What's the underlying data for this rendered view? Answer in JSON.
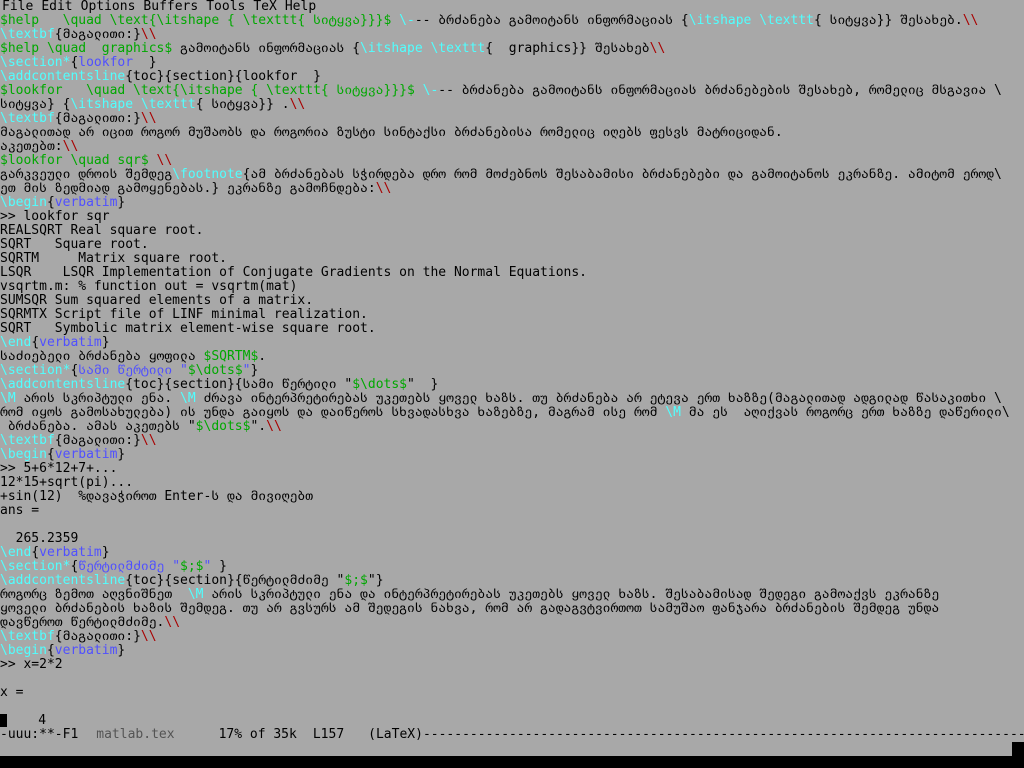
{
  "menubar": {
    "items": [
      "File",
      "Edit",
      "Options",
      "Buffers",
      "Tools",
      "TeX",
      "Help"
    ]
  },
  "buffer": {
    "lines": [
      [
        [
          "math",
          "$help   \\quad \\text{\\itshape { \\texttt{ სიტყვა}}}$ "
        ],
        [
          "cmd",
          "\\-"
        ],
        [
          "",
          "-- ბრძანება გამოიტანს ინფორმაციას {"
        ],
        [
          "cmd",
          "\\itshape \\texttt"
        ],
        [
          "",
          "{ სიტყვა}} შესახებ."
        ],
        [
          "red",
          "\\\\"
        ]
      ],
      [
        [
          "cmd",
          "\\textbf"
        ],
        [
          "",
          "{მაგალითი:}"
        ],
        [
          "red",
          "\\\\"
        ]
      ],
      [
        [
          "math",
          "$help \\quad  graphics$"
        ],
        [
          "",
          "",
          " გამოიტანს ინფორმაციას {"
        ],
        [
          "cmd",
          "\\itshape \\texttt"
        ],
        [
          "",
          "{  graphics}} შესახებ"
        ],
        [
          "red",
          "\\\\"
        ]
      ],
      [
        [
          "cmd",
          "\\section*"
        ],
        [
          "",
          "{"
        ],
        [
          "arg",
          "lookfor  "
        ],
        [
          "",
          "}"
        ]
      ],
      [
        [
          "cmd",
          "\\addcontentsline"
        ],
        [
          "",
          "{toc}{section}{lookfor  }"
        ]
      ],
      [
        [
          "math",
          "$lookfor   \\quad \\text{\\itshape { \\texttt{ სიტყვა}}}$ "
        ],
        [
          "cmd",
          "\\-"
        ],
        [
          "",
          "-- ბრძანება გამოიტანს ინფორმაციას ბრძანებების შესახებ, რომელიც მსგავია \\"
        ]
      ],
      [
        [
          "",
          "სიტყვა} {"
        ],
        [
          "cmd",
          "\\itshape \\texttt"
        ],
        [
          "",
          "{ სიტყვა}} ."
        ],
        [
          "red",
          "\\\\"
        ]
      ],
      [
        [
          "cmd",
          "\\textbf"
        ],
        [
          "",
          "{მაგალითი:}"
        ],
        [
          "red",
          "\\\\"
        ]
      ],
      [
        [
          "",
          "მაგალითად არ იცით როგორ მუშაობს და როგორია ზუსტი სინტაქსი ბრძანებისა რომელიც იღებს ფესვს მატრიციდან."
        ]
      ],
      [
        [
          "",
          "აკეთებთ:"
        ],
        [
          "red",
          "\\\\"
        ]
      ],
      [
        [
          "math",
          "$lookfor \\quad sqr$"
        ],
        [
          "red",
          " \\\\"
        ]
      ],
      [
        [
          "",
          "გარკვეული დროის შემდეგ"
        ],
        [
          "cmd",
          "\\footnote"
        ],
        [
          "",
          "{ამ ბრძანებას სჭირდება დრო რომ მოძებნოს შესაბამისი ბრძანებები და გამოიტანოს ეკრანზე. ამიტომ ეროდ\\"
        ]
      ],
      [
        [
          "",
          "ეთ მის ზედმიად გამოყენებას.} ეკრანზე გამოჩნდება:"
        ],
        [
          "red",
          "\\\\"
        ]
      ],
      [
        [
          "cmd",
          "\\begin"
        ],
        [
          "",
          "{"
        ],
        [
          "arg",
          "verbatim"
        ],
        [
          "",
          "}"
        ]
      ],
      [
        [
          "",
          ">> lookfor sqr"
        ]
      ],
      [
        [
          "",
          "REALSQRT Real square root."
        ]
      ],
      [
        [
          "",
          "SQRT   Square root."
        ]
      ],
      [
        [
          "",
          "SQRTM     Matrix square root."
        ]
      ],
      [
        [
          "",
          "LSQR    LSQR Implementation of Conjugate Gradients on the Normal Equations."
        ]
      ],
      [
        [
          "",
          "vsqrtm.m: % function out = vsqrtm(mat)"
        ]
      ],
      [
        [
          "",
          "SUMSQR Sum squared elements of a matrix."
        ]
      ],
      [
        [
          "",
          "SQRMTX Script file of LINF minimal realization."
        ]
      ],
      [
        [
          "",
          "SQRT   Symbolic matrix element-wise square root."
        ]
      ],
      [
        [
          "cmd",
          "\\end"
        ],
        [
          "",
          "{"
        ],
        [
          "arg",
          "verbatim"
        ],
        [
          "",
          "}"
        ]
      ],
      [
        [
          "",
          "საძიებელი ბრძანება ყოფილა "
        ],
        [
          "math",
          "$SQRTM$"
        ],
        [
          "",
          "."
        ]
      ],
      [
        [
          "cmd",
          "\\section*"
        ],
        [
          "",
          "{"
        ],
        [
          "arg",
          "სამი წერტილი \""
        ],
        [
          "math",
          "$\\dots$"
        ],
        [
          "arg",
          "\""
        ],
        [
          "",
          "}"
        ]
      ],
      [
        [
          "cmd",
          "\\addcontentsline"
        ],
        [
          "",
          "{toc}{section}{სამი წერტილი \""
        ],
        [
          "math",
          "$\\dots$"
        ],
        [
          "",
          "\"  }"
        ]
      ],
      [
        [
          "cmd",
          "\\M"
        ],
        [
          "",
          "",
          " არის სკრიპტული ენა. "
        ],
        [
          "cmd",
          "\\M"
        ],
        [
          "",
          "",
          " ძრავა ინტერპრეტირებას უკეთებს ყოველ ხაზს. თუ ბრძანება არ ეტევა ერთ ხაზზე(მაგალითად ადგილად წასაკითხი \\"
        ]
      ],
      [
        [
          "",
          "რომ იყოს გამოსახულება) ის უნდა გაიყოს და დაიწეროს სხვადასხვა ხაზებზე, მაგრამ ისე რომ "
        ],
        [
          "cmd",
          "\\M"
        ],
        [
          "",
          "",
          " მა ეს  აღიქვას როგორც ერთ ხაზზე დაწერილი\\"
        ]
      ],
      [
        [
          "",
          "",
          " ბრძანება. ამას აკეთებს \""
        ],
        [
          "math",
          "$\\dots$"
        ],
        [
          "",
          "\"."
        ],
        [
          "red",
          "\\\\"
        ]
      ],
      [
        [
          "cmd",
          "\\textbf"
        ],
        [
          "",
          "{მაგალითი:}"
        ],
        [
          "red",
          "\\\\"
        ]
      ],
      [
        [
          "cmd",
          "\\begin"
        ],
        [
          "",
          "{"
        ],
        [
          "arg",
          "verbatim"
        ],
        [
          "",
          "}"
        ]
      ],
      [
        [
          "",
          ">> 5+6*12+7+..."
        ]
      ],
      [
        [
          "",
          "12*15+sqrt(pi)..."
        ]
      ],
      [
        [
          "",
          "+sin(12)  %დავაჭიროთ Enter-ს და მივიღებთ"
        ]
      ],
      [
        [
          "",
          "ans ="
        ]
      ],
      [
        [
          "",
          ""
        ]
      ],
      [
        [
          "",
          "  265.2359"
        ]
      ],
      [
        [
          "cmd",
          "\\end"
        ],
        [
          "",
          "{"
        ],
        [
          "arg",
          "verbatim"
        ],
        [
          "",
          "}"
        ]
      ],
      [
        [
          "cmd",
          "\\section*"
        ],
        [
          "",
          "{"
        ],
        [
          "arg",
          "წერტილმძიმე \""
        ],
        [
          "math",
          "$;$"
        ],
        [
          "arg",
          "\""
        ],
        [
          "",
          "",
          " }"
        ]
      ],
      [
        [
          "cmd",
          "\\addcontentsline"
        ],
        [
          "",
          "{toc}{section}{წერტილმძიმე \""
        ],
        [
          "math",
          "$;$"
        ],
        [
          "",
          "\"}"
        ]
      ],
      [
        [
          "",
          "როგორც ზემოთ აღვნიშნეთ  "
        ],
        [
          "cmd",
          "\\M"
        ],
        [
          "",
          "",
          " არის სკრიპტული ენა და ინტერპრეტირებას უკეთებს ყოველ ხაზს. შესაბამისად შედეგი გამოაქვს ეკრანზე"
        ]
      ],
      [
        [
          "",
          "ყოველი ბრძანების ხაზის შემდეგ. თუ არ გვსურს ამ შედეგის ნახვა, რომ არ გადაგვტვირთოთ სამუშაო ფანჯარა ბრძანების შემდეგ უნდა"
        ]
      ],
      [
        [
          "",
          "დავწეროთ წერტილმძიმე."
        ],
        [
          "red",
          "\\\\"
        ]
      ],
      [
        [
          "cmd",
          "\\textbf"
        ],
        [
          "",
          "{მაგალითი:}"
        ],
        [
          "red",
          "\\\\"
        ]
      ],
      [
        [
          "cmd",
          "\\begin"
        ],
        [
          "",
          "{"
        ],
        [
          "arg",
          "verbatim"
        ],
        [
          "",
          "}"
        ]
      ],
      [
        [
          "",
          ">> x=2*2"
        ]
      ],
      [
        [
          "",
          ""
        ]
      ],
      [
        [
          "",
          "x ="
        ]
      ],
      [
        [
          "",
          ""
        ]
      ],
      [
        [
          "",
          "CURSOR"
        ],
        [
          "",
          "    4"
        ]
      ]
    ]
  },
  "modeline": {
    "status": "-uuu:**-F1",
    "buffer_name": "matlab.tex",
    "position": "17% of 35k",
    "line_number": "L157",
    "mode": "(LaTeX)",
    "fill": "-----------------------------------------------------------------------------------"
  }
}
